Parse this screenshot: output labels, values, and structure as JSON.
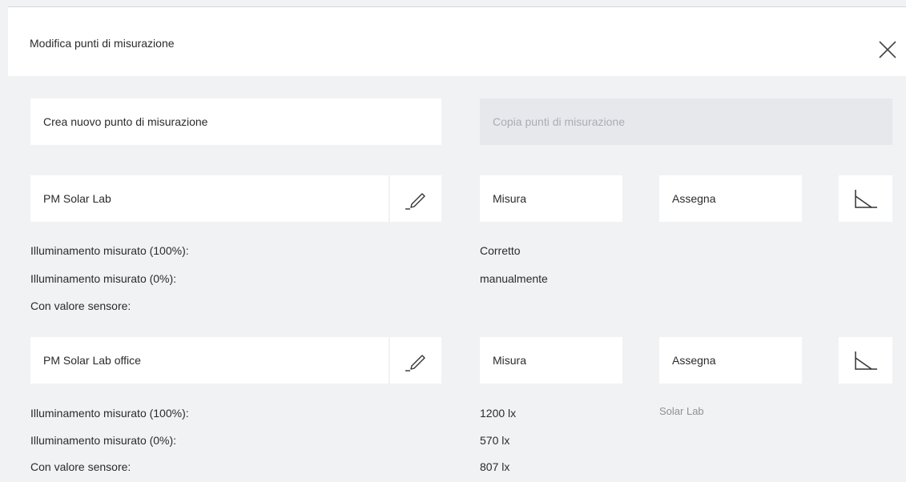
{
  "dialog": {
    "title": "Modifica punti di misurazione"
  },
  "actions": {
    "create_label": "Crea nuovo punto di misurazione",
    "copy_label": "Copia punti di misurazione"
  },
  "points": [
    {
      "name": "PM Solar Lab",
      "measure_label": "Misura",
      "assign_label": "Assegna",
      "rows": [
        {
          "label": "Illuminamento misurato (100%):",
          "value": "Corretto"
        },
        {
          "label": "Illuminamento misurato (0%):",
          "value": "manualmente"
        },
        {
          "label": "Con valore sensore:",
          "value": ""
        }
      ],
      "assigned": ""
    },
    {
      "name": "PM Solar Lab office",
      "measure_label": "Misura",
      "assign_label": "Assegna",
      "rows": [
        {
          "label": "Illuminamento misurato (100%):",
          "value": "1200 lx"
        },
        {
          "label": "Illuminamento misurato (0%):",
          "value": "570 lx"
        },
        {
          "label": "Con valore sensore:",
          "value": "807 lx"
        }
      ],
      "assigned": "Solar Lab"
    }
  ],
  "icons": {
    "close": "close-icon",
    "edit": "pencil-icon",
    "curve": "sensor-curve-icon"
  }
}
